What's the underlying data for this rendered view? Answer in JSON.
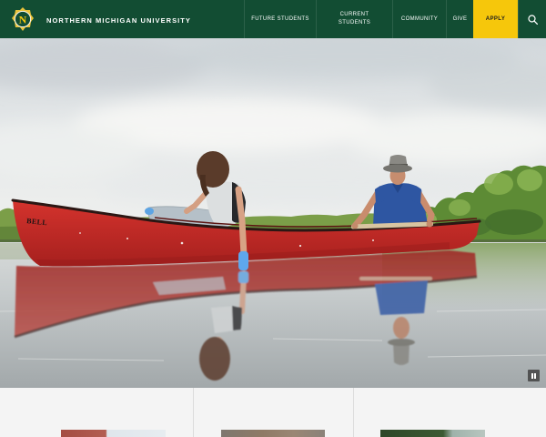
{
  "colors": {
    "brand_green": "#124d33",
    "brand_gold": "#f6c70b",
    "apply_text": "#1e1e1e"
  },
  "header": {
    "logo": {
      "icon": "nmu-emblem-icon",
      "letter": "N"
    },
    "site_name": "NORTHERN MICHIGAN UNIVERSITY",
    "nav": {
      "items": [
        {
          "label": "FUTURE STUDENTS"
        },
        {
          "label": "CURRENT STUDENTS"
        },
        {
          "label": "COMMUNITY"
        },
        {
          "label": "GIVE"
        }
      ],
      "apply": {
        "label": "APPLY"
      },
      "search": {
        "icon": "search-icon"
      }
    }
  },
  "hero": {
    "canoe_lettering": "BELL",
    "pause_control": {
      "icon": "pause-icon"
    }
  }
}
